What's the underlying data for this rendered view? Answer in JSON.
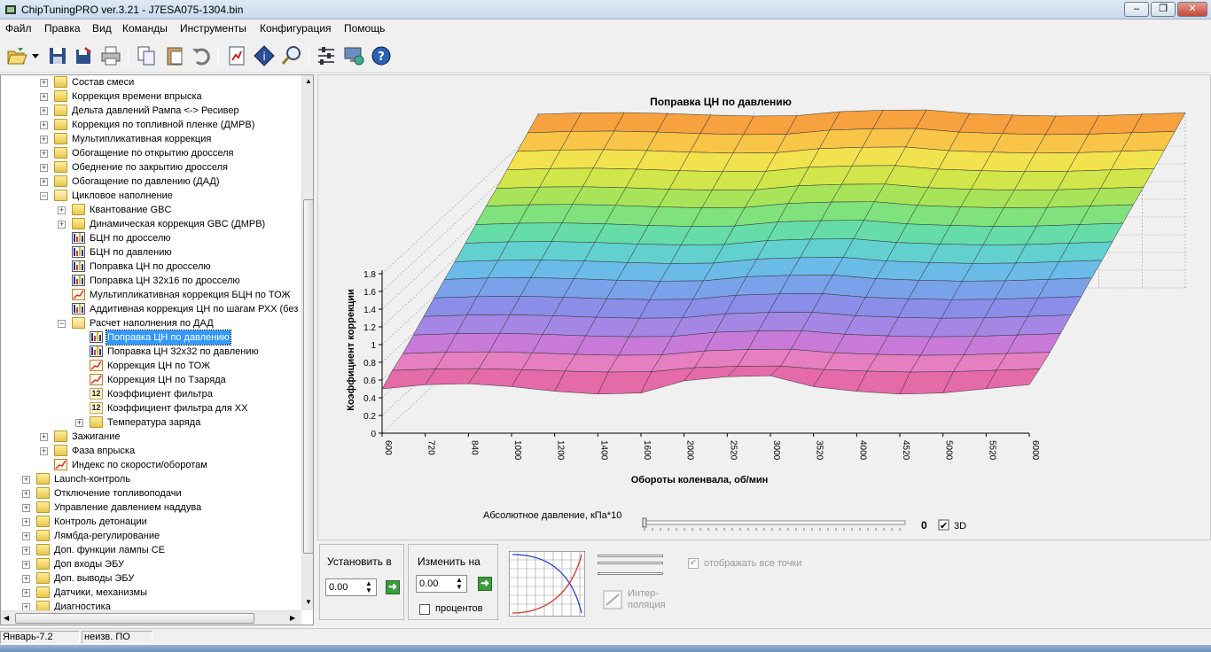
{
  "window": {
    "title": "ChipTuningPRO ver.3.21 - J7ESA075-1304.bin",
    "minimize": "–",
    "restore": "❐",
    "close": "✕"
  },
  "menu": [
    "Файл",
    "Правка",
    "Вид",
    "Команды",
    "Инструменты",
    "Конфигурация",
    "Помощь"
  ],
  "toolbar": {
    "icons": [
      "open-icon",
      "save-icon",
      "save-as-icon",
      "print-icon",
      "copy-icon",
      "paste-icon",
      "undo-icon",
      "compare-icon",
      "info-icon",
      "search-icon",
      "tools-icon",
      "network-icon",
      "help-icon"
    ]
  },
  "tree": [
    {
      "label": "Состав смеси",
      "level": 2,
      "icon": "folder",
      "exp": "+"
    },
    {
      "label": "Коррекция времени впрыска",
      "level": 2,
      "icon": "folder",
      "exp": "+"
    },
    {
      "label": "Дельта давлений Рампа <-> Ресивер",
      "level": 2,
      "icon": "folder",
      "exp": "+"
    },
    {
      "label": "Коррекция по топливной пленке (ДМРВ)",
      "level": 2,
      "icon": "folder",
      "exp": "+"
    },
    {
      "label": "Мультипликативная коррекция",
      "level": 2,
      "icon": "folder",
      "exp": "+"
    },
    {
      "label": "Обогащение по открытию дросселя",
      "level": 2,
      "icon": "folder",
      "exp": "+"
    },
    {
      "label": "Обеднение по закрытию дросселя",
      "level": 2,
      "icon": "folder",
      "exp": "+"
    },
    {
      "label": "Обогащение по давлению (ДАД)",
      "level": 2,
      "icon": "folder",
      "exp": "+"
    },
    {
      "label": "Цикловое наполнение",
      "level": 2,
      "icon": "folder-open",
      "exp": "−"
    },
    {
      "label": "Квантование GBC",
      "level": 3,
      "icon": "folder",
      "exp": "+"
    },
    {
      "label": "Динамическая коррекция GBC (ДМРВ)",
      "level": 3,
      "icon": "folder",
      "exp": "+"
    },
    {
      "label": "БЦН по дросселю",
      "level": 3,
      "icon": "bars",
      "exp": ""
    },
    {
      "label": "БЦН по давлению",
      "level": 3,
      "icon": "bars",
      "exp": ""
    },
    {
      "label": "Поправка ЦН по дросселю",
      "level": 3,
      "icon": "bars",
      "exp": ""
    },
    {
      "label": "Поправка ЦН 32x16 по дросселю",
      "level": 3,
      "icon": "bars",
      "exp": ""
    },
    {
      "label": "Мультипликативная коррекция БЦН по ТОЖ",
      "level": 3,
      "icon": "curve",
      "exp": ""
    },
    {
      "label": "Аддитивная коррекция ЦН по шагам РХХ (без",
      "level": 3,
      "icon": "bars",
      "exp": ""
    },
    {
      "label": "Расчет наполнения по ДАД",
      "level": 3,
      "icon": "folder-open",
      "exp": "−"
    },
    {
      "label": "Поправка ЦН по давлению",
      "level": 4,
      "icon": "bars",
      "exp": "",
      "selected": true
    },
    {
      "label": "Поправка ЦН 32x32 по давлению",
      "level": 4,
      "icon": "bars",
      "exp": ""
    },
    {
      "label": "Коррекция ЦН по ТОЖ",
      "level": 4,
      "icon": "curve",
      "exp": ""
    },
    {
      "label": "Коррекция ЦН по Тзаряда",
      "level": 4,
      "icon": "curve",
      "exp": ""
    },
    {
      "label": "Коэффициент фильтра",
      "level": 4,
      "icon": "num12",
      "exp": ""
    },
    {
      "label": "Коэффициент фильтра для ХХ",
      "level": 4,
      "icon": "num12",
      "exp": ""
    },
    {
      "label": "Температура заряда",
      "level": 4,
      "icon": "folder",
      "exp": "+"
    },
    {
      "label": "Зажигание",
      "level": 2,
      "icon": "folder",
      "exp": "+"
    },
    {
      "label": "Фаза впрыска",
      "level": 2,
      "icon": "folder",
      "exp": "+"
    },
    {
      "label": "Индекс по скорости/оборотам",
      "level": 2,
      "icon": "curve",
      "exp": ""
    },
    {
      "label": "Launch-контроль",
      "level": 1,
      "icon": "folder",
      "exp": "+"
    },
    {
      "label": "Отключение топливоподачи",
      "level": 1,
      "icon": "folder",
      "exp": "+"
    },
    {
      "label": "Управление давлением наддува",
      "level": 1,
      "icon": "folder",
      "exp": "+"
    },
    {
      "label": "Контроль детонации",
      "level": 1,
      "icon": "folder",
      "exp": "+"
    },
    {
      "label": "Лямбда-регулирование",
      "level": 1,
      "icon": "folder",
      "exp": "+"
    },
    {
      "label": "Доп. функции лампы CE",
      "level": 1,
      "icon": "folder",
      "exp": "+"
    },
    {
      "label": "Доп входы ЭБУ",
      "level": 1,
      "icon": "folder",
      "exp": "+"
    },
    {
      "label": "Доп. выводы ЭБУ",
      "level": 1,
      "icon": "folder",
      "exp": "+"
    },
    {
      "label": "Датчики, механизмы",
      "level": 1,
      "icon": "folder",
      "exp": "+"
    },
    {
      "label": "Диагностика",
      "level": 1,
      "icon": "folder",
      "exp": "+"
    }
  ],
  "chart_data": {
    "type": "surface3d",
    "title": "Поправка ЦН по давлению",
    "xlabel": "Обороты коленвала, об/мин",
    "ylabel": "Коэффициент коррекции",
    "x_ticks": [
      "600",
      "720",
      "840",
      "1000",
      "1200",
      "1400",
      "1600",
      "2000",
      "2520",
      "3000",
      "3520",
      "4000",
      "4520",
      "5000",
      "5520",
      "6000"
    ],
    "z_ticks": [
      "0",
      "0.2",
      "0.4",
      "0.6",
      "0.8",
      "1",
      "1.2",
      "1.4",
      "1.6",
      "1.8"
    ],
    "ylim": [
      0,
      2
    ],
    "slider_label": "Абсолютное давление, кПа*10",
    "slider_value": "0",
    "view_3d": true,
    "view_3d_label": "3D",
    "depth_rows": 16,
    "row_levels": [
      0.5,
      0.6,
      0.68,
      0.78,
      0.88,
      0.98,
      1.08,
      1.17,
      1.27,
      1.37,
      1.47,
      1.56,
      1.66,
      1.76,
      1.86,
      1.96
    ],
    "row_colors": [
      "#e46aa8",
      "#e57fc0",
      "#c87ad8",
      "#a487e4",
      "#8a8ee8",
      "#7aa2ea",
      "#6bbbe8",
      "#62d0cf",
      "#66dca9",
      "#7fe27c",
      "#a8e45a",
      "#d0e64a",
      "#f2e24e",
      "#f8c548",
      "#f7a13f",
      "#f26b3e"
    ]
  },
  "controls": {
    "set_label": "Установить в",
    "set_value": "0.00",
    "change_label": "Изменить на",
    "change_value": "0.00",
    "percent_label": "процентов",
    "interp_label": "Интер-\nполяция",
    "show_all_label": "отображать все точки"
  },
  "status": {
    "firmware": "Январь-7.2",
    "software": "неизв. ПО"
  }
}
